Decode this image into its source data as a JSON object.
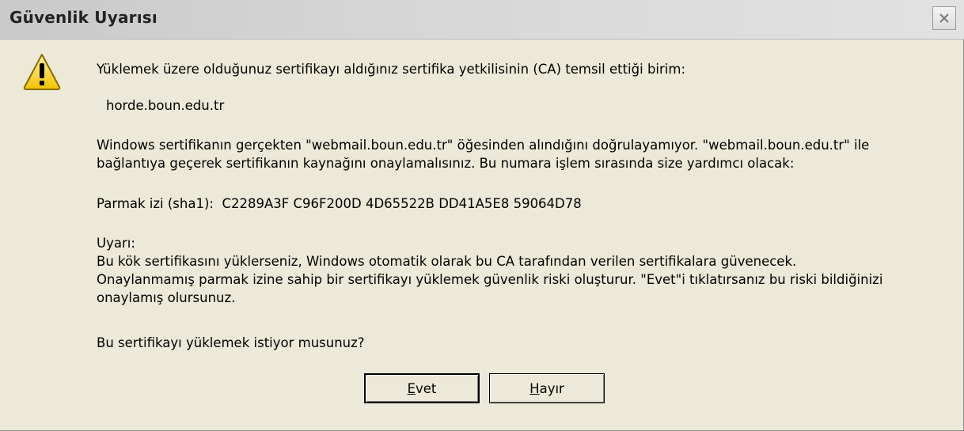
{
  "window": {
    "title": "Güvenlik Uyarısı",
    "close_icon": "close-icon"
  },
  "icons": {
    "warning": "warning-icon"
  },
  "message": {
    "intro": "Yüklemek üzere olduğunuz sertifikayı aldığınız sertifika yetkilisinin (CA) temsil ettiği birim:",
    "issuer": "horde.boun.edu.tr",
    "verify_line1": "Windows sertifikanın gerçekten \"webmail.boun.edu.tr\" öğesinden alındığını doğrulayamıyor. \"webmail.boun.edu.tr\" ile",
    "verify_line2": "bağlantıya geçerek sertifikanın kaynağını onaylamalısınız. Bu numara işlem sırasında size yardımcı olacak:",
    "thumbprint_label": "Parmak izi (sha1):",
    "thumbprint_value": "C2289A3F C96F200D 4D65522B DD41A5E8 59064D78",
    "warning_label": "Uyarı:",
    "warning_line1": "Bu kök sertifikasını yüklerseniz, Windows otomatik olarak bu CA tarafından verilen sertifikalara güvenecek.",
    "warning_line2": "Onaylanmamış parmak izine sahip bir sertifikayı yüklemek güvenlik riski oluşturur. \"Evet\"i tıklatırsanız bu riski bildiğinizi",
    "warning_line3": "onaylamış olursunuz.",
    "question": "Bu sertifikayı yüklemek istiyor musunuz?"
  },
  "buttons": {
    "yes_accel": "E",
    "yes_rest": "vet",
    "no_accel": "H",
    "no_rest": "ayır"
  }
}
